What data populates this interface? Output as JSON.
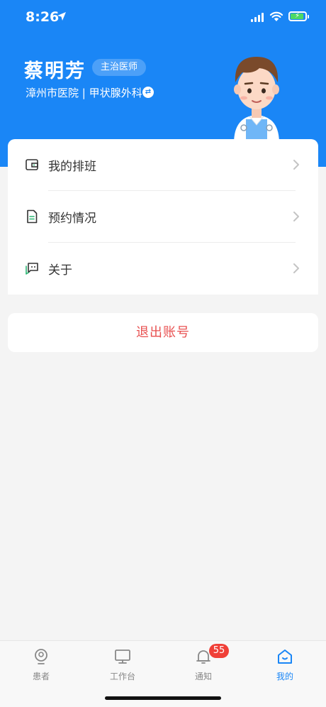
{
  "status_bar": {
    "time": "8:26"
  },
  "profile": {
    "name": "蔡明芳",
    "title_badge": "主治医师",
    "hospital_department": "漳州市医院 | 甲状腺外科"
  },
  "menu": {
    "items": [
      {
        "label": "我的排班",
        "icon": "schedule-icon"
      },
      {
        "label": "预约情况",
        "icon": "document-icon"
      },
      {
        "label": "关于",
        "icon": "chat-icon"
      }
    ]
  },
  "logout": {
    "label": "退出账号"
  },
  "tabbar": {
    "tabs": [
      {
        "label": "患者",
        "icon": "patient-icon"
      },
      {
        "label": "工作台",
        "icon": "monitor-icon"
      },
      {
        "label": "通知",
        "icon": "bell-icon",
        "badge": "55"
      },
      {
        "label": "我的",
        "icon": "home-icon",
        "active": true
      }
    ]
  },
  "colors": {
    "primary": "#1a86f6",
    "logout_text": "#e85050",
    "badge": "#f04038",
    "background": "#f4f4f4"
  }
}
